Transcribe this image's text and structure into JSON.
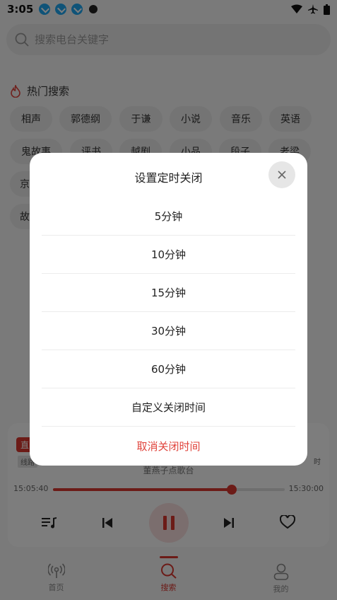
{
  "status_bar": {
    "time": "3:05"
  },
  "search": {
    "placeholder": "搜索电台关键字"
  },
  "hot_search": {
    "title": "热门搜索",
    "row1": [
      "相声",
      "郭德纲",
      "于谦",
      "小说",
      "音乐",
      "英语"
    ],
    "row2": [
      "鬼故事",
      "评书",
      "越剧",
      "小品",
      "段子",
      "老梁"
    ],
    "row3_left": "京",
    "row4_left": "故"
  },
  "player": {
    "live_badge": "直",
    "line_label": "线路",
    "station": "董燕子点歌台",
    "time_start": "15:05:40",
    "time_end": "15:30:00",
    "progress_percent": 77,
    "timer_label": "时"
  },
  "tabs": [
    {
      "label": "首页"
    },
    {
      "label": "搜索"
    },
    {
      "label": "我的"
    }
  ],
  "dialog": {
    "title": "设置定时关闭",
    "options": [
      "5分钟",
      "10分钟",
      "15分钟",
      "30分钟",
      "60分钟",
      "自定义关闭时间"
    ],
    "cancel": "取消关闭时间"
  },
  "colors": {
    "accent": "#d9362f",
    "cancel": "#e0433b"
  }
}
